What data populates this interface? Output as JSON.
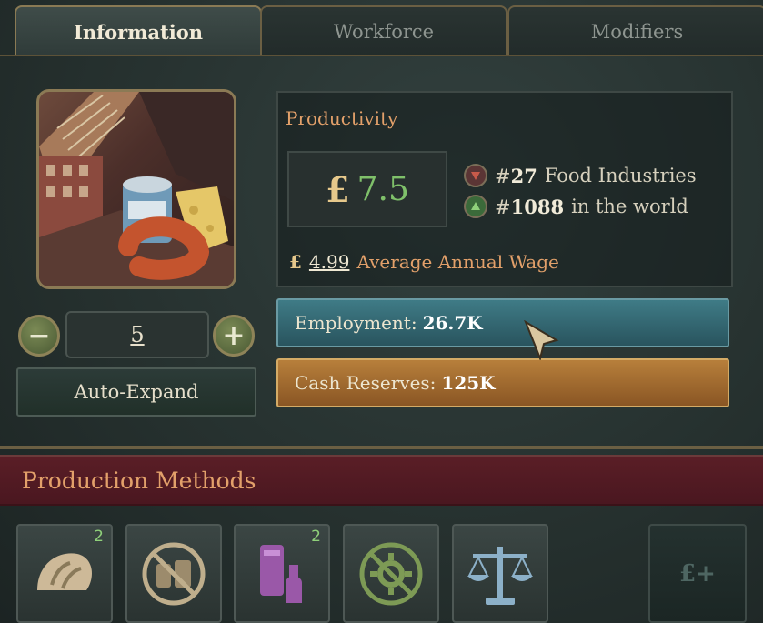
{
  "tabs": [
    {
      "label": "Information",
      "active": true
    },
    {
      "label": "Workforce",
      "active": false
    },
    {
      "label": "Modifiers",
      "active": false
    }
  ],
  "building": {
    "image_icon": "canned-food-sausage-cheese-illustration",
    "level": "5",
    "auto_expand_label": "Auto-Expand"
  },
  "productivity": {
    "title": "Productivity",
    "currency_symbol": "£",
    "value": "7.5",
    "rank_category_prefix": "#",
    "rank_category_num": "27",
    "rank_category_label": "Food Industries",
    "rank_world_prefix": "#",
    "rank_world_num": "1088",
    "rank_world_label": "in the world",
    "wage_symbol": "£",
    "wage_amount": "4.99",
    "wage_label": "Average Annual Wage"
  },
  "employment": {
    "label": "Employment:",
    "value": "26.7K"
  },
  "cash": {
    "label": "Cash Reserves:",
    "value": "125K"
  },
  "production_methods": {
    "title": "Production Methods",
    "slots": [
      {
        "icon": "bread-icon",
        "badge": "2"
      },
      {
        "icon": "canned-goods-disabled-icon",
        "badge": ""
      },
      {
        "icon": "distillery-icon",
        "badge": "2"
      },
      {
        "icon": "automation-disabled-icon",
        "badge": ""
      },
      {
        "icon": "scales-icon",
        "badge": ""
      },
      {
        "icon": "pound-plus-icon",
        "label": "£+"
      }
    ]
  },
  "colors": {
    "accent_orange": "#e2a06a",
    "employment_bar": "#3f7b86",
    "cash_bar": "#b77f3b",
    "productivity_green": "#7fc06a",
    "header_maroon": "#5a1e26"
  }
}
